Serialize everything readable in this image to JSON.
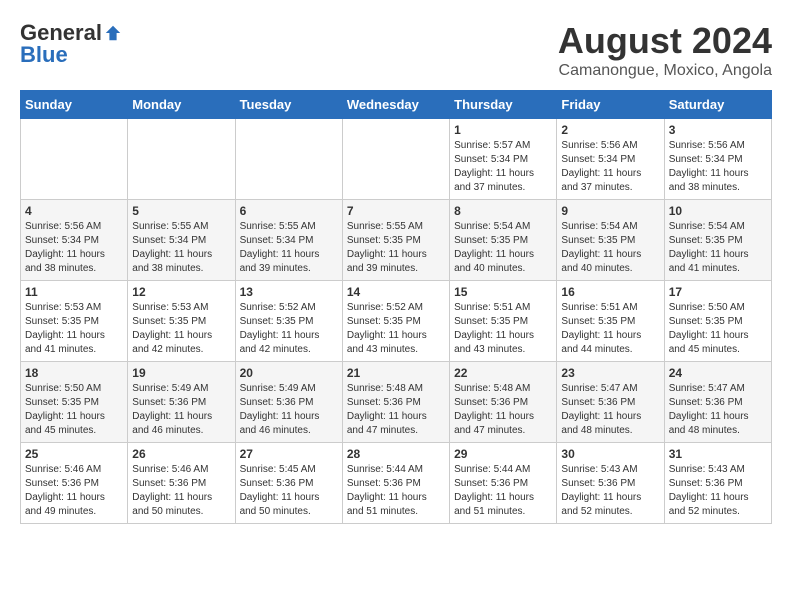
{
  "logo": {
    "general": "General",
    "blue": "Blue"
  },
  "title": "August 2024",
  "subtitle": "Camanongue, Moxico, Angola",
  "days_of_week": [
    "Sunday",
    "Monday",
    "Tuesday",
    "Wednesday",
    "Thursday",
    "Friday",
    "Saturday"
  ],
  "weeks": [
    [
      {
        "day": "",
        "info": ""
      },
      {
        "day": "",
        "info": ""
      },
      {
        "day": "",
        "info": ""
      },
      {
        "day": "",
        "info": ""
      },
      {
        "day": "1",
        "info": "Sunrise: 5:57 AM\nSunset: 5:34 PM\nDaylight: 11 hours\nand 37 minutes."
      },
      {
        "day": "2",
        "info": "Sunrise: 5:56 AM\nSunset: 5:34 PM\nDaylight: 11 hours\nand 37 minutes."
      },
      {
        "day": "3",
        "info": "Sunrise: 5:56 AM\nSunset: 5:34 PM\nDaylight: 11 hours\nand 38 minutes."
      }
    ],
    [
      {
        "day": "4",
        "info": "Sunrise: 5:56 AM\nSunset: 5:34 PM\nDaylight: 11 hours\nand 38 minutes."
      },
      {
        "day": "5",
        "info": "Sunrise: 5:55 AM\nSunset: 5:34 PM\nDaylight: 11 hours\nand 38 minutes."
      },
      {
        "day": "6",
        "info": "Sunrise: 5:55 AM\nSunset: 5:34 PM\nDaylight: 11 hours\nand 39 minutes."
      },
      {
        "day": "7",
        "info": "Sunrise: 5:55 AM\nSunset: 5:35 PM\nDaylight: 11 hours\nand 39 minutes."
      },
      {
        "day": "8",
        "info": "Sunrise: 5:54 AM\nSunset: 5:35 PM\nDaylight: 11 hours\nand 40 minutes."
      },
      {
        "day": "9",
        "info": "Sunrise: 5:54 AM\nSunset: 5:35 PM\nDaylight: 11 hours\nand 40 minutes."
      },
      {
        "day": "10",
        "info": "Sunrise: 5:54 AM\nSunset: 5:35 PM\nDaylight: 11 hours\nand 41 minutes."
      }
    ],
    [
      {
        "day": "11",
        "info": "Sunrise: 5:53 AM\nSunset: 5:35 PM\nDaylight: 11 hours\nand 41 minutes."
      },
      {
        "day": "12",
        "info": "Sunrise: 5:53 AM\nSunset: 5:35 PM\nDaylight: 11 hours\nand 42 minutes."
      },
      {
        "day": "13",
        "info": "Sunrise: 5:52 AM\nSunset: 5:35 PM\nDaylight: 11 hours\nand 42 minutes."
      },
      {
        "day": "14",
        "info": "Sunrise: 5:52 AM\nSunset: 5:35 PM\nDaylight: 11 hours\nand 43 minutes."
      },
      {
        "day": "15",
        "info": "Sunrise: 5:51 AM\nSunset: 5:35 PM\nDaylight: 11 hours\nand 43 minutes."
      },
      {
        "day": "16",
        "info": "Sunrise: 5:51 AM\nSunset: 5:35 PM\nDaylight: 11 hours\nand 44 minutes."
      },
      {
        "day": "17",
        "info": "Sunrise: 5:50 AM\nSunset: 5:35 PM\nDaylight: 11 hours\nand 45 minutes."
      }
    ],
    [
      {
        "day": "18",
        "info": "Sunrise: 5:50 AM\nSunset: 5:35 PM\nDaylight: 11 hours\nand 45 minutes."
      },
      {
        "day": "19",
        "info": "Sunrise: 5:49 AM\nSunset: 5:36 PM\nDaylight: 11 hours\nand 46 minutes."
      },
      {
        "day": "20",
        "info": "Sunrise: 5:49 AM\nSunset: 5:36 PM\nDaylight: 11 hours\nand 46 minutes."
      },
      {
        "day": "21",
        "info": "Sunrise: 5:48 AM\nSunset: 5:36 PM\nDaylight: 11 hours\nand 47 minutes."
      },
      {
        "day": "22",
        "info": "Sunrise: 5:48 AM\nSunset: 5:36 PM\nDaylight: 11 hours\nand 47 minutes."
      },
      {
        "day": "23",
        "info": "Sunrise: 5:47 AM\nSunset: 5:36 PM\nDaylight: 11 hours\nand 48 minutes."
      },
      {
        "day": "24",
        "info": "Sunrise: 5:47 AM\nSunset: 5:36 PM\nDaylight: 11 hours\nand 48 minutes."
      }
    ],
    [
      {
        "day": "25",
        "info": "Sunrise: 5:46 AM\nSunset: 5:36 PM\nDaylight: 11 hours\nand 49 minutes."
      },
      {
        "day": "26",
        "info": "Sunrise: 5:46 AM\nSunset: 5:36 PM\nDaylight: 11 hours\nand 50 minutes."
      },
      {
        "day": "27",
        "info": "Sunrise: 5:45 AM\nSunset: 5:36 PM\nDaylight: 11 hours\nand 50 minutes."
      },
      {
        "day": "28",
        "info": "Sunrise: 5:44 AM\nSunset: 5:36 PM\nDaylight: 11 hours\nand 51 minutes."
      },
      {
        "day": "29",
        "info": "Sunrise: 5:44 AM\nSunset: 5:36 PM\nDaylight: 11 hours\nand 51 minutes."
      },
      {
        "day": "30",
        "info": "Sunrise: 5:43 AM\nSunset: 5:36 PM\nDaylight: 11 hours\nand 52 minutes."
      },
      {
        "day": "31",
        "info": "Sunrise: 5:43 AM\nSunset: 5:36 PM\nDaylight: 11 hours\nand 52 minutes."
      }
    ]
  ]
}
